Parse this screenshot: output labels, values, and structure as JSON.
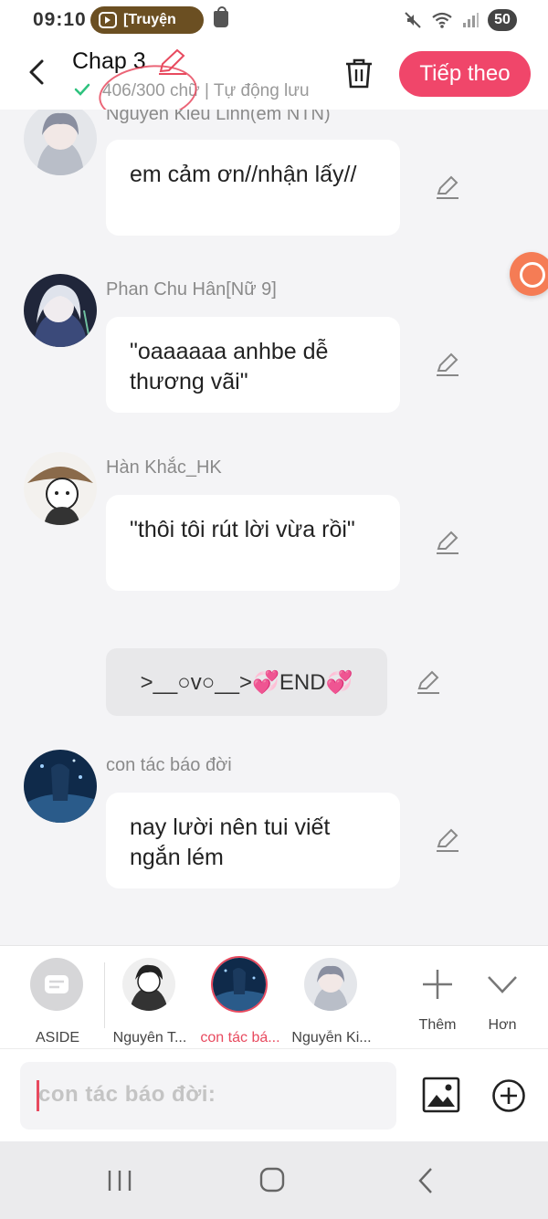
{
  "status_bar": {
    "time": "09:10",
    "notification_text": "[Truyện",
    "battery": "50",
    "icons": [
      "app-icon",
      "shopping-bag-icon",
      "mute-icon",
      "wifi-icon",
      "signal-icon",
      "battery-icon"
    ]
  },
  "header": {
    "title": "Chap 3",
    "word_count": "406/300 chữ | Tự động lưu",
    "next_label": "Tiếp theo",
    "icons": [
      "back-icon",
      "edit-icon",
      "check-icon",
      "trash-icon"
    ],
    "colors": {
      "accent": "#f0466a",
      "annotation": "#e84a5f"
    }
  },
  "messages": [
    {
      "sender": "Nguyễn Kiều Linh(em NTN)",
      "text": "em cảm ơn//nhận lấy//"
    },
    {
      "sender": "Phan Chu Hân[Nữ 9]",
      "text": "\"oaaaaaa anhbe dễ thương vãi\""
    },
    {
      "sender": "Hàn Khắc_HK",
      "text": "\"thôi tôi rút lời vừa rồi\""
    },
    {
      "sender": "",
      "text": ">__○v○__>💞END💞",
      "type": "aside"
    },
    {
      "sender": "con tác báo đời",
      "text": "nay lười nên tui viết ngắn lém"
    }
  ],
  "character_bar": {
    "items": [
      {
        "label": "ASIDE"
      },
      {
        "label": "Nguyên T..."
      },
      {
        "label": "con tác bá...",
        "selected": true
      },
      {
        "label": "Nguyễn Ki..."
      }
    ],
    "more_label": "Thêm",
    "expand_label": "Hơn"
  },
  "input": {
    "placeholder": "con tác báo đời:",
    "icons": [
      "image-icon",
      "plus-circle-icon"
    ]
  },
  "nav_bar": {
    "icons": [
      "recent-apps-icon",
      "home-icon",
      "back-icon"
    ]
  }
}
